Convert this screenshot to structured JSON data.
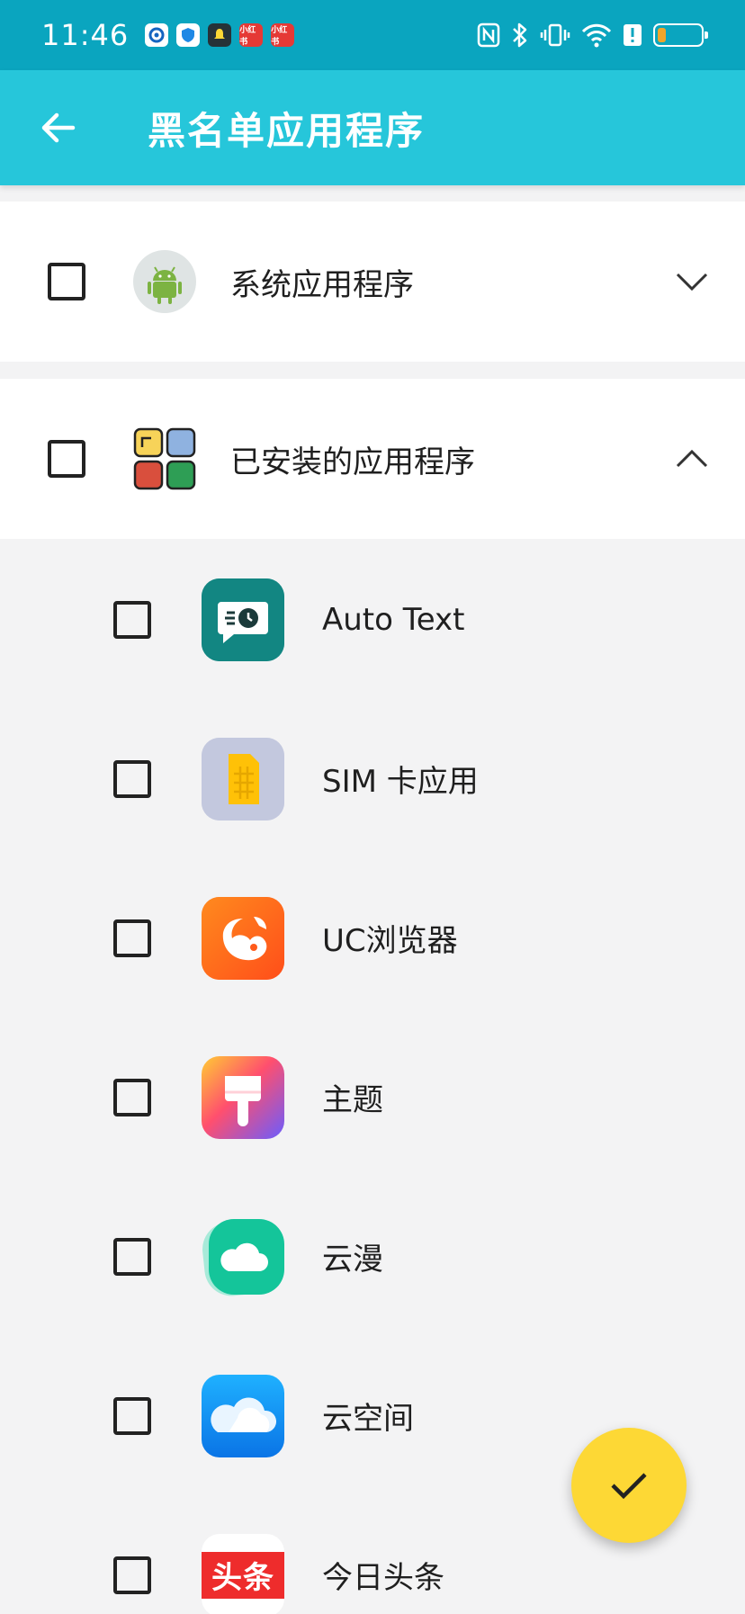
{
  "status_bar": {
    "time": "11:46",
    "notifications": [
      {
        "icon": "circle-app-icon",
        "color": "#1565c0",
        "text": ""
      },
      {
        "icon": "shield-icon",
        "color": "#1e88e5",
        "text": ""
      },
      {
        "icon": "bell-app-icon",
        "color": "#263238",
        "text": ""
      },
      {
        "icon": "xiaohongshu-icon",
        "color": "#e53935",
        "text": "小红书"
      },
      {
        "icon": "xiaohongshu-icon",
        "color": "#e53935",
        "text": "小红书"
      }
    ],
    "system_icons": [
      "nfc-icon",
      "bluetooth-icon",
      "vibrate-icon",
      "wifi-icon",
      "alert-icon",
      "battery-icon"
    ],
    "battery_level": 0.2
  },
  "app_bar": {
    "title": "黑名单应用程序",
    "back_icon": "arrow-left-icon"
  },
  "sections": [
    {
      "label": "系统应用程序",
      "icon": "android-icon",
      "expanded": false,
      "checked": false
    },
    {
      "label": "已安装的应用程序",
      "icon": "apps-grid-icon",
      "expanded": true,
      "checked": false
    }
  ],
  "apps": [
    {
      "label": "Auto Text",
      "icon": "auto-text-icon",
      "checked": false
    },
    {
      "label": "SIM 卡应用",
      "icon": "sim-card-icon",
      "checked": false
    },
    {
      "label": "UC浏览器",
      "icon": "uc-browser-icon",
      "checked": false
    },
    {
      "label": "主题",
      "icon": "theme-brush-icon",
      "checked": false
    },
    {
      "label": "云漫",
      "icon": "cloud-comic-icon",
      "checked": false
    },
    {
      "label": "云空间",
      "icon": "cloud-storage-icon",
      "checked": false
    },
    {
      "label": "今日头条",
      "icon": "toutiao-icon",
      "icon_text": "头条",
      "checked": false
    }
  ],
  "fab": {
    "icon": "check-icon",
    "color": "#fdd835"
  },
  "colors": {
    "status_bar": "#0aa5bf",
    "app_bar": "#26c6da",
    "background": "#f3f3f4"
  }
}
